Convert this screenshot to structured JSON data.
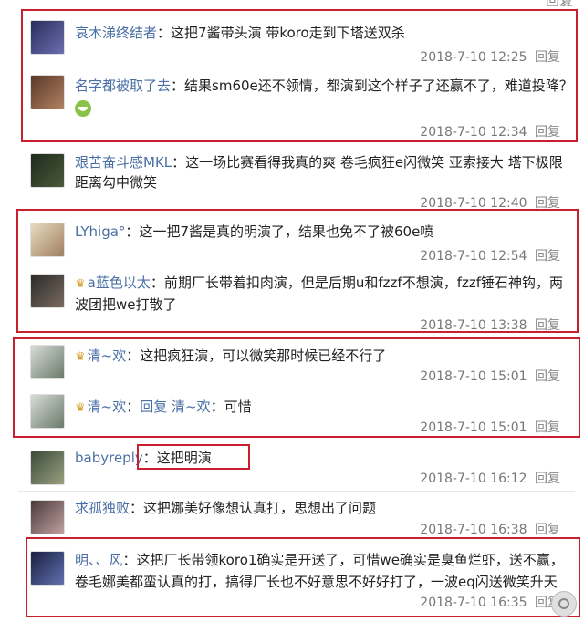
{
  "top_fragment": "回复",
  "comments": [
    {
      "user": "哀木涕终结者",
      "text": "这把7酱带头演 带koro走到下塔送双杀",
      "time": "2018-7-10 12:25",
      "reply": "回复"
    },
    {
      "user": "名字都被取了去",
      "text": "结果sm60e还不领情，都演到这个样子了还赢不了，难道投降？",
      "time": "2018-7-10 12:34",
      "reply": "回复"
    },
    {
      "user": "艰苦奋斗感MKL",
      "text_line1": "这一场比赛看得我真的爽 卷毛疯狂e闪微笑 亚索接大 塔下极限",
      "text_line2": "距离勾中微笑",
      "time": "2018-7-10 12:40",
      "reply": "回复"
    },
    {
      "user": "LYhiga°",
      "text": "这一把7酱是真的明演了，结果也免不了被60e喷",
      "time": "2018-7-10 12:54",
      "reply": "回复"
    },
    {
      "user": "a蓝色以太",
      "text_line1": "前期厂长带着扣肉演，但是后期u和fzzf不想演，fzzf锤石神钩，两",
      "text_line2": "波团把we打散了",
      "time": "2018-7-10 13:38",
      "reply": "回复"
    },
    {
      "user": "清~欢",
      "text": "这把疯狂演，可以微笑那时候已经不行了",
      "time": "2018-7-10 15:01",
      "reply": "回复"
    },
    {
      "user": "清~欢",
      "reply_word": "回复",
      "reply_to": "清~欢",
      "text": "可惜",
      "time": "2018-7-10 15:01",
      "reply": "回复"
    },
    {
      "user": "babyreply",
      "text": "这把明演",
      "time": "2018-7-10 16:12",
      "reply": "回复"
    },
    {
      "user": "求孤独败",
      "text": "这把娜美好像想认真打，思想出了问题",
      "time": "2018-7-10 16:38",
      "reply": "回复"
    },
    {
      "user": "明、、风",
      "text_line1": "这把厂长带领koro1确实是开送了，可惜we确实是臭鱼烂虾，送不赢，",
      "text_line2": "卷毛娜美都蛮认真的打，搞得厂长也不好意思不好好打了，一波eq闪送微笑升天",
      "time": "2018-7-10 16:35",
      "reply": "回复"
    }
  ],
  "colors": {
    "annotation_box": "#c8202c",
    "username": "#4a6fa5"
  }
}
